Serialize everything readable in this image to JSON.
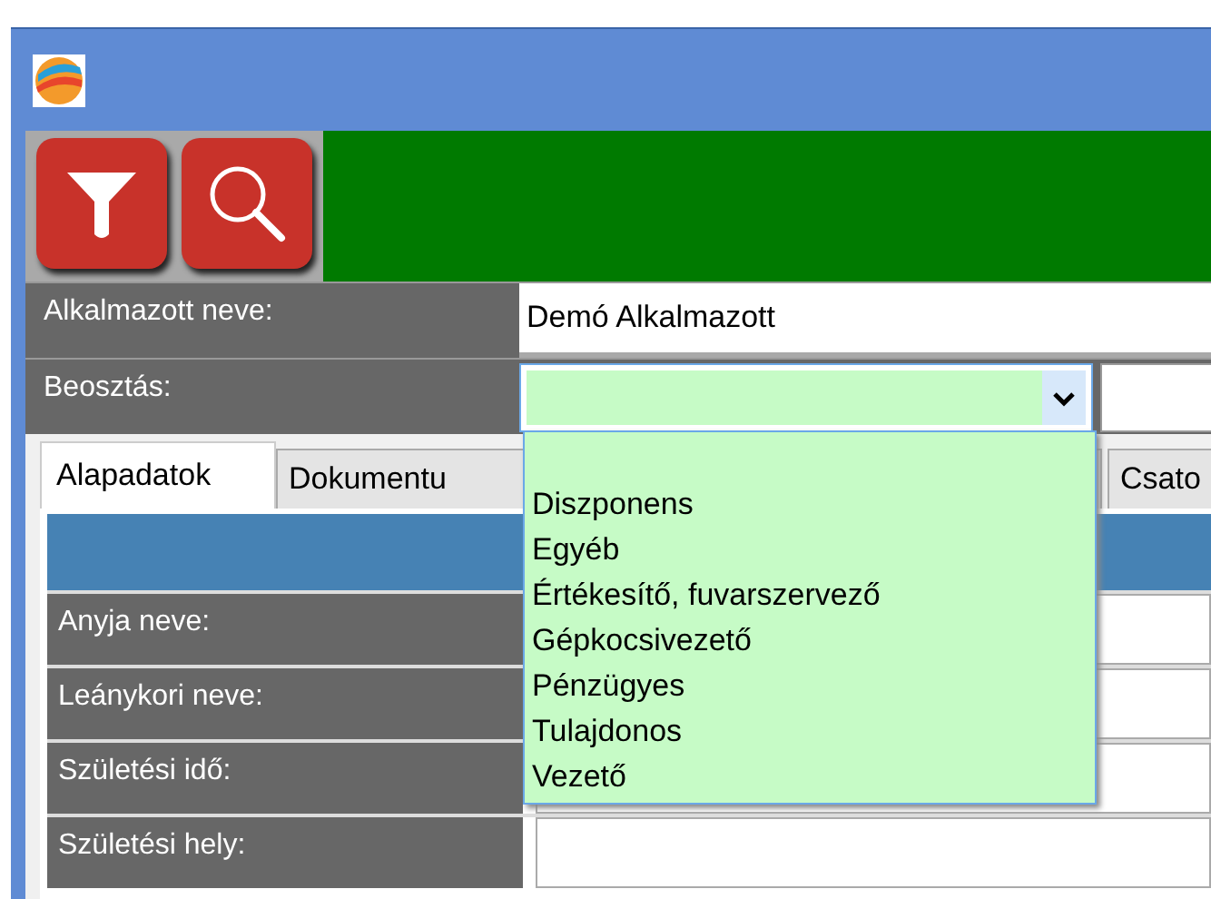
{
  "toolbar": {
    "buttons": [
      {
        "kind": "filter"
      },
      {
        "kind": "search"
      }
    ]
  },
  "fields": [
    {
      "label": "Alkalmazott neve:",
      "kind": "text",
      "value": "Demó Alkalmazott"
    },
    {
      "label": "Beosztás:",
      "kind": "combo",
      "expanded": true
    }
  ],
  "tabs": [
    {
      "label": "Alapadatok",
      "selected": true
    },
    {
      "label": "Dokumentu",
      "selected": false
    },
    {
      "label": "Csato",
      "selected": false
    }
  ],
  "form_rows": [
    {
      "label": "Anyja neve:"
    },
    {
      "label": "Leánykori neve:"
    },
    {
      "label": "Születési idő:"
    },
    {
      "label": "Születési hely:"
    }
  ],
  "dropdown": {
    "options": [
      "Diszponens",
      "Egyéb",
      "Értékesítő, fuvarszervező",
      "Gépkocsivezető",
      "Pénzügyes",
      "Tulajdonos",
      "Vezető"
    ]
  }
}
